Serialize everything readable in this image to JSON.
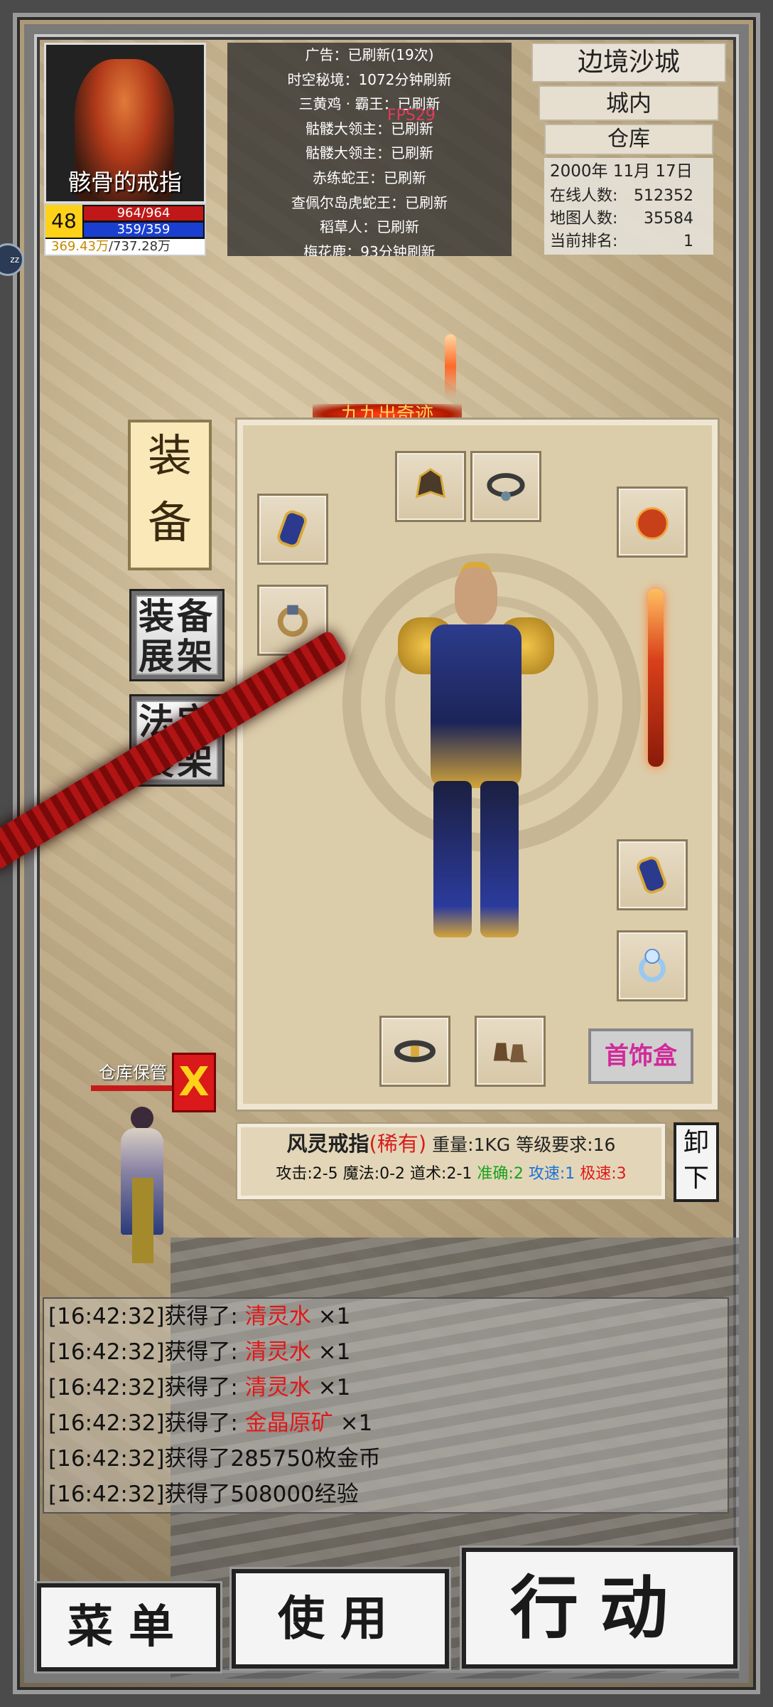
{
  "player": {
    "name": "骸骨的戒指",
    "level": "48",
    "hp": "964/964",
    "mp": "359/359",
    "exp_current": "369.43万",
    "exp_total": "/737.28万"
  },
  "announcements": [
    "广告：已刷新(19次)",
    "时空秘境：1072分钟刷新",
    "三黄鸡 · 霸王：已刷新",
    "骷髅大领主：已刷新",
    "骷髅大领主：已刷新",
    "赤练蛇王：已刷新",
    "查佩尔岛虎蛇王：已刷新",
    "稻草人：已刷新",
    "梅花鹿：93分钟刷新"
  ],
  "fps": "FPS29",
  "location": {
    "region": "边境沙城",
    "area": "城内",
    "place": "仓库",
    "date": "2000年 11月 17日",
    "online_label": "在线人数:",
    "online_value": "512352",
    "map_label": "地图人数:",
    "map_value": "35584",
    "rank_label": "当前排名:",
    "rank_value": "1"
  },
  "banner": "九九出奇迹",
  "side_menu": {
    "equip_tab": [
      "装",
      "备"
    ],
    "equip_display": "装备展架",
    "treasure_display": "法宝展架"
  },
  "equip_slots": [
    {
      "name": "helmet",
      "icon": "helmet-icon"
    },
    {
      "name": "necklace",
      "icon": "necklace-icon"
    },
    {
      "name": "bracelet-left",
      "icon": "bracelet-icon"
    },
    {
      "name": "orb",
      "icon": "orb-icon"
    },
    {
      "name": "ring-left",
      "icon": "ring-icon"
    },
    {
      "name": "bracelet-right",
      "icon": "bracelet-icon"
    },
    {
      "name": "ring-right",
      "icon": "ring-icon"
    },
    {
      "name": "belt",
      "icon": "belt-icon"
    },
    {
      "name": "boots",
      "icon": "boots-icon"
    }
  ],
  "jewelry_box": "首饰盒",
  "item": {
    "name": "风灵戒指",
    "rarity": "(稀有)",
    "weight": "重量:1KG",
    "req": "等级要求:16",
    "attack": "攻击:2-5",
    "magic": "魔法:0-2",
    "taoism": "道术:2-1",
    "accuracy": "准确:2",
    "atk_speed": "攻速:1",
    "agility": "极速:3",
    "accuracy_color": "#17a21a",
    "atk_speed_color": "#1a72d8",
    "agility_color": "#e01818"
  },
  "unequip": "卸下",
  "keeper": {
    "label": "仓库保管",
    "close": "X"
  },
  "chat": [
    {
      "time": "[16:42:32]",
      "text": "获得了:",
      "item": "清灵水",
      "qty": "×1"
    },
    {
      "time": "[16:42:32]",
      "text": "获得了:",
      "item": "清灵水",
      "qty": "×1"
    },
    {
      "time": "[16:42:32]",
      "text": "获得了:",
      "item": "清灵水",
      "qty": "×1"
    },
    {
      "time": "[16:42:32]",
      "text": "获得了:",
      "item": "金晶原矿",
      "qty": "×1"
    },
    {
      "time": "[16:42:32]",
      "text": "获得了285750枚金币",
      "item": "",
      "qty": ""
    },
    {
      "time": "[16:42:32]",
      "text": "获得了508000经验",
      "item": "",
      "qty": ""
    }
  ],
  "buttons": {
    "menu": "菜单",
    "use": "使用",
    "action": "行动"
  },
  "colors": {
    "accent_red": "#d9191a",
    "hp": "#c01818",
    "mp": "#1a3fd0",
    "level_bg": "#ffd21a",
    "jewel": "#d12a9a"
  }
}
